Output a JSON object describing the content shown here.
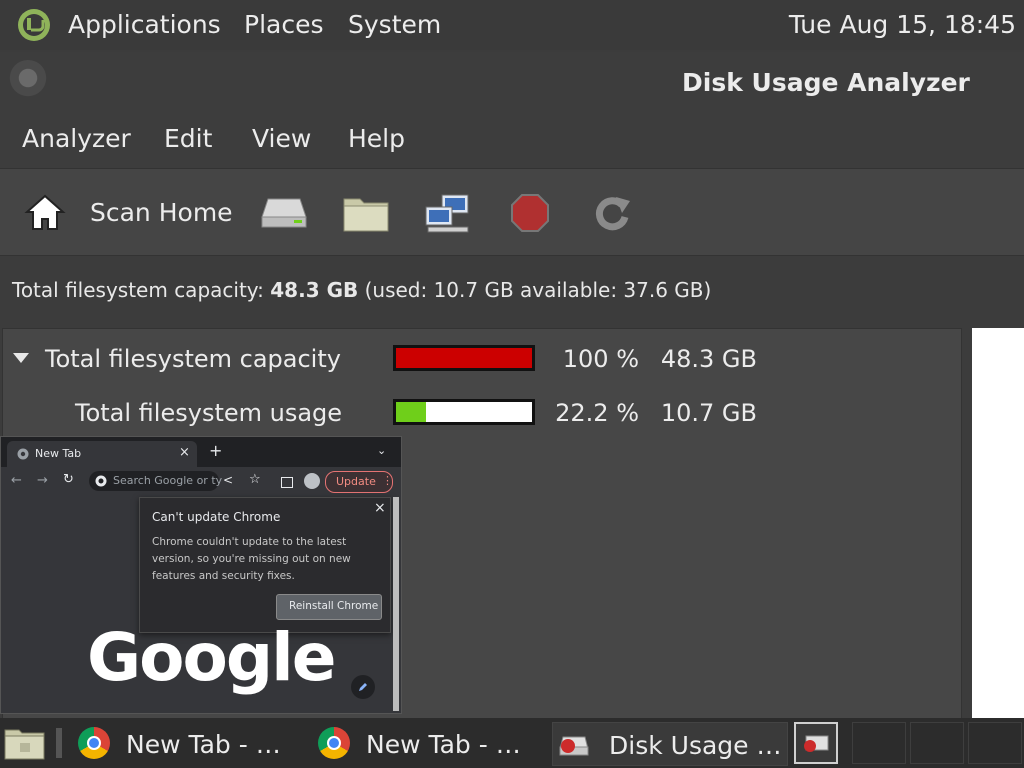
{
  "top_panel": {
    "menus": [
      "Applications",
      "Places",
      "System"
    ],
    "clock": "Tue Aug 15, 18:45"
  },
  "window": {
    "title": "Disk Usage Analyzer",
    "menubar": [
      "Analyzer",
      "Edit",
      "View",
      "Help"
    ],
    "toolbar": {
      "scan_home_label": "Scan Home",
      "icons": [
        "home-icon",
        "drive-icon",
        "folder-icon",
        "network-icon",
        "stop-icon",
        "refresh-icon"
      ]
    },
    "capacity_line": {
      "prefix": "Total filesystem capacity: ",
      "total": "48.3 GB",
      "suffix": " (used: 10.7 GB available: 37.6 GB)"
    },
    "rows": [
      {
        "name": "Total filesystem capacity",
        "percent": "100 %",
        "size": "48.3 GB",
        "fill_fraction": 1.0,
        "fill_color": "#cc0000"
      },
      {
        "name": "Total filesystem usage",
        "percent": "22.2 %",
        "size": "10.7 GB",
        "fill_fraction": 0.222,
        "fill_color": "#6fcf1a"
      }
    ]
  },
  "chrome_preview": {
    "tab_title": "New Tab",
    "new_tab_symbol": "+",
    "address_placeholder": "Search Google or ty",
    "update_label": "Update",
    "popup": {
      "title": "Can't update Chrome",
      "body": "Chrome couldn't update to the latest version, so you're missing out on new features and security fixes.",
      "button": "Reinstall Chrome",
      "close": "×"
    },
    "logo_text": "Google"
  },
  "taskbar": {
    "items": [
      {
        "label": "New Tab - …",
        "icon": "chrome-icon"
      },
      {
        "label": "New Tab - …",
        "icon": "chrome-icon"
      },
      {
        "label": "Disk Usage …",
        "icon": "disk-usage-icon"
      }
    ]
  },
  "colors": {
    "capacity_bar": "#cc0000",
    "usage_bar": "#6fcf1a"
  }
}
